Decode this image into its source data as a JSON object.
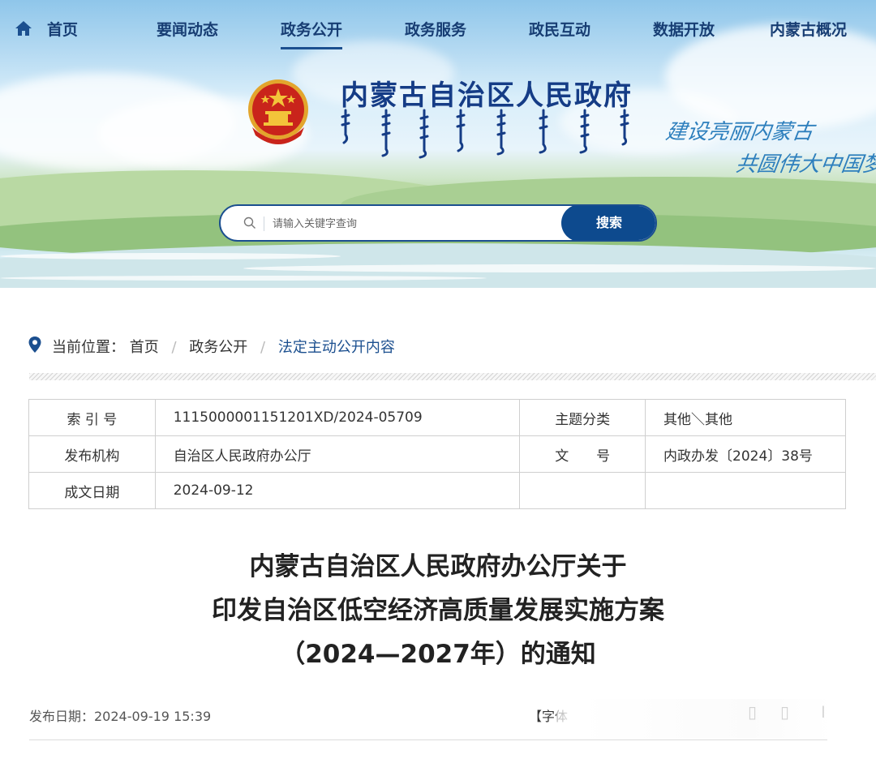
{
  "nav": {
    "items": [
      {
        "label": "首页"
      },
      {
        "label": "要闻动态"
      },
      {
        "label": "政务公开"
      },
      {
        "label": "政务服务"
      },
      {
        "label": "政民互动"
      },
      {
        "label": "数据开放"
      },
      {
        "label": "内蒙古概况"
      }
    ],
    "active_index": 2
  },
  "header": {
    "site_title": "内蒙古自治区人民政府",
    "slogan_line1": "建设亮丽内蒙古",
    "slogan_line2": "共圆伟大中国梦"
  },
  "search": {
    "placeholder": "请输入关键字查询",
    "button_label": "搜索"
  },
  "breadcrumb": {
    "label": "当前位置：",
    "items": [
      "首页",
      "政务公开",
      "法定主动公开内容"
    ],
    "separator": "/"
  },
  "info": {
    "index_label": "索 引 号",
    "index_value": "1115000001151201XD/2024-05709",
    "topic_label": "主题分类",
    "topic_value": "其他＼其他",
    "org_label": "发布机构",
    "org_value": "自治区人民政府办公厅",
    "docno_label": "文　　号",
    "docno_value": "内政办发〔2024〕38号",
    "date_label": "成文日期",
    "date_value": "2024-09-12"
  },
  "document": {
    "title_line1": "内蒙古自治区人民政府办公厅关于",
    "title_line2": "印发自治区低空经济高质量发展实施方案",
    "title_line3": "（2024—2027年）的通知",
    "publish_date": "发布日期：2024-09-19 15:39",
    "font_size_label": "【字体"
  },
  "colors": {
    "nav_text": "#173d73",
    "accent": "#0d4a8e",
    "title_blue": "#153c86",
    "slogan": "#2d7fbd"
  },
  "icons": {
    "home": "home-icon",
    "search": "search-icon",
    "location": "location-pin-icon",
    "emblem": "national-emblem"
  }
}
